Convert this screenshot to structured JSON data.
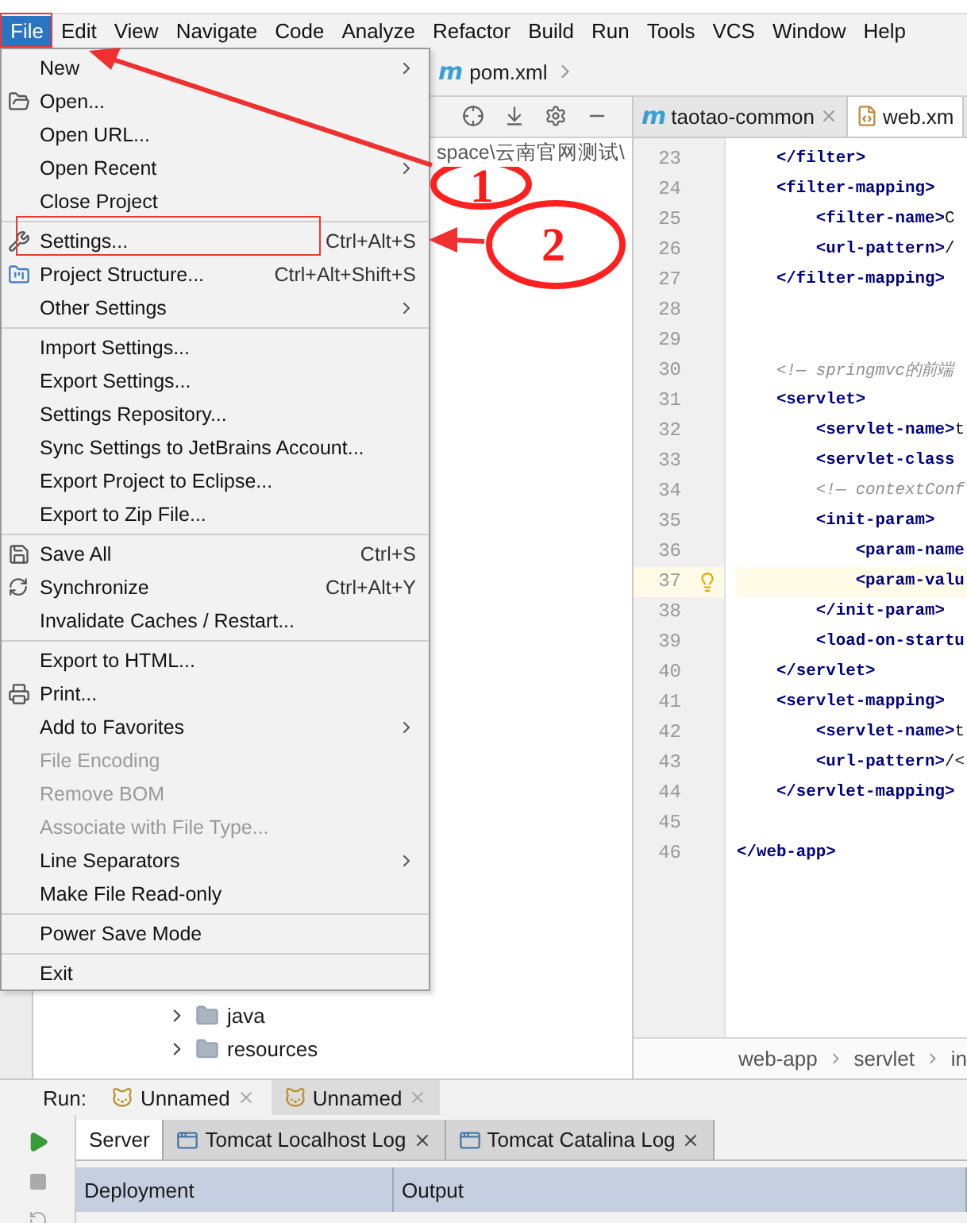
{
  "menu_bar": [
    {
      "label": "File",
      "selected": true
    },
    {
      "label": "Edit",
      "selected": false
    },
    {
      "label": "View",
      "selected": false
    },
    {
      "label": "Navigate",
      "selected": false
    },
    {
      "label": "Code",
      "selected": false
    },
    {
      "label": "Analyze",
      "selected": false
    },
    {
      "label": "Refactor",
      "selected": false
    },
    {
      "label": "Build",
      "selected": false
    },
    {
      "label": "Run",
      "selected": false
    },
    {
      "label": "Tools",
      "selected": false
    },
    {
      "label": "VCS",
      "selected": false
    },
    {
      "label": "Window",
      "selected": false
    },
    {
      "label": "Help",
      "selected": false
    }
  ],
  "navigation": {
    "icon_letter": "m",
    "file": "pom.xml"
  },
  "project_panel": {
    "path": "space\\云南官网测试\\",
    "tree": [
      {
        "label": "java",
        "expanded": false
      },
      {
        "label": "resources",
        "expanded": false
      }
    ]
  },
  "editor": {
    "tabs": [
      {
        "icon_letter": "m",
        "label": "taotao-common",
        "selected": false,
        "closable": true
      },
      {
        "label": "web.xm",
        "selected": true,
        "closable": false
      }
    ],
    "lines": [
      {
        "number": "23",
        "kind": "tag",
        "text": "    </filter>",
        "current": false
      },
      {
        "number": "24",
        "kind": "tag",
        "text": "    <filter-mapping>",
        "current": false
      },
      {
        "number": "25",
        "kind": "mixed",
        "text": "        **<filter-name>**C",
        "current": false
      },
      {
        "number": "26",
        "kind": "mixed",
        "text": "        **<url-pattern>**/",
        "current": false
      },
      {
        "number": "27",
        "kind": "tag",
        "text": "    </filter-mapping>",
        "current": false
      },
      {
        "number": "28",
        "kind": "empty",
        "current": false
      },
      {
        "number": "29",
        "kind": "empty",
        "current": false
      },
      {
        "number": "30",
        "kind": "comment",
        "text": "    <!— springmvc的前端",
        "current": false
      },
      {
        "number": "31",
        "kind": "tag",
        "text": "    <servlet>",
        "current": false
      },
      {
        "number": "32",
        "kind": "mixed",
        "text": "        **<servlet-name>**t",
        "current": false
      },
      {
        "number": "33",
        "kind": "tag",
        "text": "        <servlet-class",
        "current": false
      },
      {
        "number": "34",
        "kind": "comment",
        "text": "        <!— contextConf",
        "current": false
      },
      {
        "number": "35",
        "kind": "tag",
        "text": "        <init-param>",
        "current": false
      },
      {
        "number": "36",
        "kind": "tag",
        "text": "            <param-name",
        "current": false
      },
      {
        "number": "37",
        "kind": "tag",
        "text": "            <param-valu",
        "current": true
      },
      {
        "number": "38",
        "kind": "tag",
        "text": "        </init-param>",
        "current": false
      },
      {
        "number": "39",
        "kind": "tag",
        "text": "        <load-on-startu",
        "current": false
      },
      {
        "number": "40",
        "kind": "tag",
        "text": "    </servlet>",
        "current": false
      },
      {
        "number": "41",
        "kind": "tag",
        "text": "    <servlet-mapping>",
        "current": false
      },
      {
        "number": "42",
        "kind": "mixed",
        "text": "        **<servlet-name>**t",
        "current": false
      },
      {
        "number": "43",
        "kind": "mixed",
        "text": "        **<url-pattern>**/<",
        "current": false
      },
      {
        "number": "44",
        "kind": "tag",
        "text": "    </servlet-mapping>",
        "current": false
      },
      {
        "number": "45",
        "kind": "empty",
        "current": false
      },
      {
        "number": "46",
        "kind": "tag",
        "text": "</web-app>",
        "current": false
      }
    ],
    "breadcrumbs": [
      "web-app",
      "servlet",
      "in"
    ]
  },
  "file_menu": [
    {
      "kind": "item",
      "label": "New",
      "submenu": true
    },
    {
      "kind": "item",
      "label": "Open..."
    },
    {
      "kind": "item",
      "label": "Open URL..."
    },
    {
      "kind": "item",
      "label": "Open Recent",
      "submenu": true
    },
    {
      "kind": "item",
      "label": "Close Project"
    },
    {
      "kind": "separator"
    },
    {
      "kind": "item",
      "label": "Settings...",
      "shortcut": "Ctrl+Alt+S"
    },
    {
      "kind": "item",
      "label": "Project Structure...",
      "shortcut": "Ctrl+Alt+Shift+S"
    },
    {
      "kind": "item",
      "label": "Other Settings",
      "submenu": true
    },
    {
      "kind": "separator"
    },
    {
      "kind": "item",
      "label": "Import Settings..."
    },
    {
      "kind": "item",
      "label": "Export Settings..."
    },
    {
      "kind": "item",
      "label": "Settings Repository..."
    },
    {
      "kind": "item",
      "label": "Sync Settings to JetBrains Account..."
    },
    {
      "kind": "item",
      "label": "Export Project to Eclipse..."
    },
    {
      "kind": "item",
      "label": "Export to Zip File..."
    },
    {
      "kind": "separator"
    },
    {
      "kind": "item",
      "label": "Save All",
      "shortcut": "Ctrl+S"
    },
    {
      "kind": "item",
      "label": "Synchronize",
      "shortcut": "Ctrl+Alt+Y"
    },
    {
      "kind": "item",
      "label": "Invalidate Caches / Restart..."
    },
    {
      "kind": "separator"
    },
    {
      "kind": "item",
      "label": "Export to HTML..."
    },
    {
      "kind": "item",
      "label": "Print..."
    },
    {
      "kind": "item",
      "label": "Add to Favorites",
      "submenu": true
    },
    {
      "kind": "item",
      "label": "File Encoding",
      "disabled": true
    },
    {
      "kind": "item",
      "label": "Remove BOM",
      "disabled": true
    },
    {
      "kind": "item",
      "label": "Associate with File Type...",
      "disabled": true
    },
    {
      "kind": "item",
      "label": "Line Separators",
      "submenu": true
    },
    {
      "kind": "item",
      "label": "Make File Read-only"
    },
    {
      "kind": "separator"
    },
    {
      "kind": "item",
      "label": "Power Save Mode"
    },
    {
      "kind": "separator"
    },
    {
      "kind": "item",
      "label": "Exit"
    }
  ],
  "run_panel": {
    "label": "Run:",
    "tabs": [
      {
        "label": "Unnamed",
        "selected": false
      },
      {
        "label": "Unnamed",
        "selected": true
      }
    ],
    "server_tabs": [
      {
        "label": "Server",
        "selected": true,
        "closable": false
      },
      {
        "label": "Tomcat Localhost Log",
        "selected": false,
        "closable": true
      },
      {
        "label": "Tomcat Catalina Log",
        "selected": false,
        "closable": true
      }
    ],
    "columns": [
      "Deployment",
      "Output"
    ]
  },
  "annotations": [
    {
      "label": "1"
    },
    {
      "label": "2"
    }
  ]
}
